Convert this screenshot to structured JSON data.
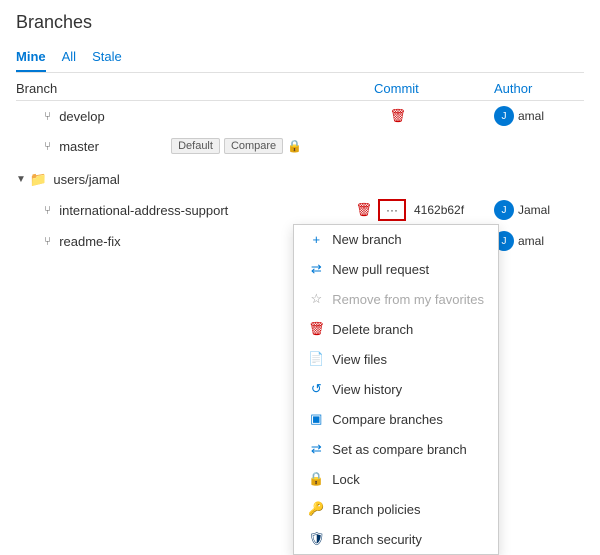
{
  "page": {
    "title": "Branches"
  },
  "tabs": [
    {
      "id": "mine",
      "label": "Mine",
      "active": true
    },
    {
      "id": "all",
      "label": "All",
      "active": false
    },
    {
      "id": "stale",
      "label": "Stale",
      "active": false
    }
  ],
  "table_headers": {
    "branch": "Branch",
    "commit": "Commit",
    "author": "Author"
  },
  "group": {
    "name": "users/jamal"
  },
  "branches": [
    {
      "name": "international-address-support",
      "commit": "4162b62f",
      "author": "Jamal",
      "showMore": true,
      "showDelete": true,
      "star": false
    },
    {
      "name": "readme-fix",
      "commit": "",
      "author": "amal",
      "showDelete": true,
      "star": false
    }
  ],
  "top_branches": [
    {
      "name": "develop",
      "commit": "",
      "author": "amal",
      "showDelete": true,
      "star": false
    },
    {
      "name": "master",
      "commit": "",
      "author": "",
      "badges": [
        "Default",
        "Compare"
      ],
      "showDelete": false,
      "star": true,
      "lock": true
    }
  ],
  "dropdown": {
    "items": [
      {
        "id": "new-branch",
        "label": "New branch",
        "icon": "+",
        "iconClass": "blue"
      },
      {
        "id": "new-pr",
        "label": "New pull request",
        "icon": "⇄",
        "iconClass": "blue"
      },
      {
        "id": "remove-fav",
        "label": "Remove from my favorites",
        "icon": "☆",
        "iconClass": "gray",
        "disabled": true
      },
      {
        "id": "delete-branch",
        "label": "Delete branch",
        "icon": "🗑",
        "iconClass": "red"
      },
      {
        "id": "view-files",
        "label": "View files",
        "icon": "📄",
        "iconClass": "blue"
      },
      {
        "id": "view-history",
        "label": "View history",
        "icon": "↺",
        "iconClass": "blue"
      },
      {
        "id": "compare-branches",
        "label": "Compare branches",
        "icon": "▣",
        "iconClass": "blue"
      },
      {
        "id": "set-compare",
        "label": "Set as compare branch",
        "icon": "⇄",
        "iconClass": "blue"
      },
      {
        "id": "lock",
        "label": "Lock",
        "icon": "🔒",
        "iconClass": "gray"
      },
      {
        "id": "branch-policies",
        "label": "Branch policies",
        "icon": "🔑",
        "iconClass": "gray"
      },
      {
        "id": "branch-security",
        "label": "Branch security",
        "icon": "🛡",
        "iconClass": "shield"
      }
    ]
  }
}
